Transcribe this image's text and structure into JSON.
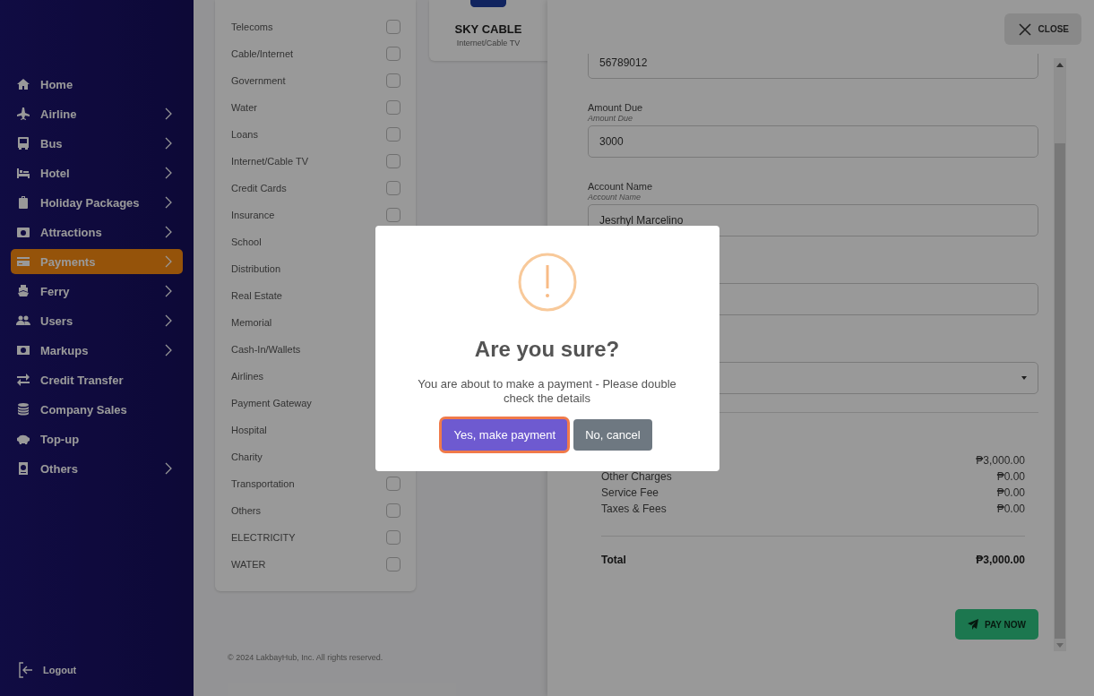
{
  "sidebar": {
    "items": [
      {
        "label": "Home",
        "expandable": false,
        "selected": false
      },
      {
        "label": "Airline",
        "expandable": true,
        "selected": false
      },
      {
        "label": "Bus",
        "expandable": true,
        "selected": false
      },
      {
        "label": "Hotel",
        "expandable": true,
        "selected": false
      },
      {
        "label": "Holiday Packages",
        "expandable": true,
        "selected": false
      },
      {
        "label": "Attractions",
        "expandable": true,
        "selected": false
      },
      {
        "label": "Payments",
        "expandable": true,
        "selected": true
      },
      {
        "label": "Ferry",
        "expandable": true,
        "selected": false
      },
      {
        "label": "Users",
        "expandable": true,
        "selected": false
      },
      {
        "label": "Markups",
        "expandable": true,
        "selected": false
      },
      {
        "label": "Credit Transfer",
        "expandable": false,
        "selected": false
      },
      {
        "label": "Company Sales",
        "expandable": false,
        "selected": false
      },
      {
        "label": "Top-up",
        "expandable": false,
        "selected": false
      },
      {
        "label": "Others",
        "expandable": true,
        "selected": false
      }
    ],
    "logout": "Logout"
  },
  "categories": [
    {
      "label": "Telecoms",
      "checked": false
    },
    {
      "label": "Cable/Internet",
      "checked": false
    },
    {
      "label": "Government",
      "checked": false
    },
    {
      "label": "Water",
      "checked": false
    },
    {
      "label": "Loans",
      "checked": false
    },
    {
      "label": "Internet/Cable TV",
      "checked": false
    },
    {
      "label": "Credit Cards",
      "checked": false
    },
    {
      "label": "Insurance",
      "checked": false
    },
    {
      "label": "School"
    },
    {
      "label": "Distribution"
    },
    {
      "label": "Real Estate"
    },
    {
      "label": "Memorial"
    },
    {
      "label": "Cash-In/Wallets"
    },
    {
      "label": "Airlines"
    },
    {
      "label": "Payment Gateway"
    },
    {
      "label": "Hospital"
    },
    {
      "label": "Charity"
    },
    {
      "label": "Transportation",
      "checked": false
    },
    {
      "label": "Others",
      "checked": false
    },
    {
      "label": "ELECTRICITY",
      "checked": false
    },
    {
      "label": "WATER",
      "checked": false
    }
  ],
  "footer": "© 2024 LakbayHub, Inc. All rights reserved.",
  "biller_card": {
    "name": "SKY CABLE",
    "category": "Internet/Cable TV"
  },
  "payment_panel": {
    "close": "CLOSE",
    "fields": [
      {
        "kind": "text",
        "value": "56789012"
      },
      {
        "kind": "text",
        "label": "Amount Due",
        "sublabel": "Amount Due",
        "value": "3000"
      },
      {
        "kind": "text",
        "label": "Account Name",
        "sublabel": "Account Name",
        "value": "Jesrhyl Marcelino"
      },
      {
        "kind": "text"
      },
      {
        "kind": "select"
      }
    ],
    "summary": [
      {
        "value": "₱3,000.00"
      },
      {
        "label": "Other Charges",
        "value": "₱0.00"
      },
      {
        "label": "Service Fee",
        "value": "₱0.00"
      },
      {
        "label": "Taxes & Fees",
        "value": "₱0.00"
      }
    ],
    "total": {
      "label": "Total",
      "value": "₱3,000.00"
    },
    "pay_button": "PAY NOW"
  },
  "dialog": {
    "title": "Are you sure?",
    "message": "You are about to make a payment - Please double check the details",
    "buttons": [
      {
        "label": "Yes, make payment",
        "kind": "confirm",
        "focused": true
      },
      {
        "label": "No, cancel",
        "kind": "cancel",
        "focused": false
      }
    ]
  }
}
